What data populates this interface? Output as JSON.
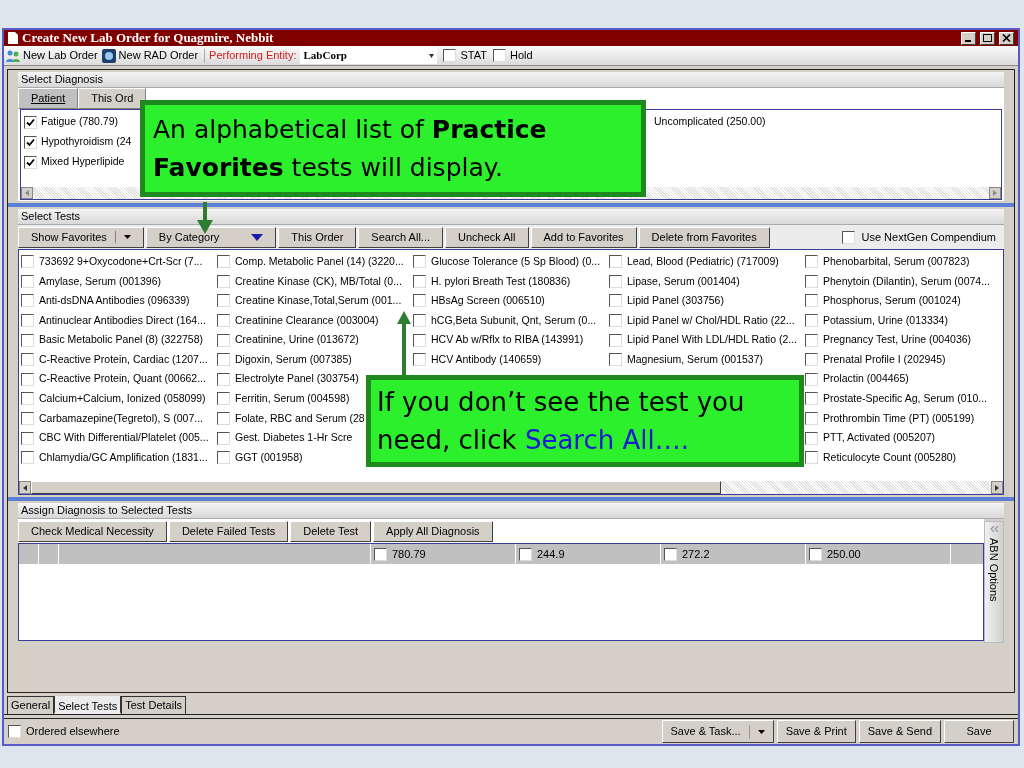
{
  "window": {
    "title": "Create New Lab Order for Quagmire, Nebbit"
  },
  "toolbar": {
    "new_lab_order": "New Lab Order",
    "new_rad_order": "New RAD Order",
    "performing_entity_label": "Performing Entity:",
    "performing_entity_value": "LabCorp",
    "options": [
      {
        "label": "STAT",
        "checked": false
      },
      {
        "label": "Hold",
        "checked": false
      }
    ]
  },
  "select_diagnosis": {
    "title": "Select Diagnosis",
    "tabs": [
      {
        "label": "Patient",
        "selected": true
      },
      {
        "label": "This Ord",
        "selected": false
      }
    ],
    "items": [
      {
        "label": "Fatigue (780.79)",
        "checked": true
      },
      {
        "label": "Hypothyroidism (24",
        "checked": true
      },
      {
        "label": "Mixed Hyperlipide",
        "checked": true
      }
    ],
    "partial_item": "Uncomplicated (250.00)"
  },
  "select_tests": {
    "title": "Select Tests",
    "buttons": [
      {
        "label": "Show Favorites",
        "kind": "split"
      },
      {
        "label": "By Category",
        "kind": "dropdown"
      },
      {
        "label": "This Order",
        "kind": "plain"
      },
      {
        "label": "Search All...",
        "kind": "plain"
      },
      {
        "label": "Uncheck All",
        "kind": "plain"
      },
      {
        "label": "Add to Favorites",
        "kind": "plain"
      },
      {
        "label": "Delete from Favorites",
        "kind": "plain"
      }
    ],
    "compendium": {
      "label": "Use NextGen Compendium",
      "checked": false
    },
    "columns": [
      [
        {
          "label": "733692 9+Oxycodone+Crt-Scr (7...",
          "checked": false
        },
        {
          "label": "Amylase, Serum (001396)",
          "checked": false
        },
        {
          "label": "Anti-dsDNA Antibodies (096339)",
          "checked": false
        },
        {
          "label": "Antinuclear Antibodies Direct (164...",
          "checked": false
        },
        {
          "label": "Basic Metabolic Panel (8) (322758)",
          "checked": false
        },
        {
          "label": "C-Reactive Protein, Cardiac (1207...",
          "checked": false
        },
        {
          "label": "C-Reactive Protein, Quant (00662...",
          "checked": false
        },
        {
          "label": "Calcium+Calcium, Ionized (058099)",
          "checked": false
        },
        {
          "label": "Carbamazepine(Tegretol), S (007...",
          "checked": false
        },
        {
          "label": "CBC With Differential/Platelet (005...",
          "checked": false
        },
        {
          "label": "Chlamydia/GC Amplification (1831...",
          "checked": false
        }
      ],
      [
        {
          "label": "Comp. Metabolic Panel (14) (3220...",
          "checked": false
        },
        {
          "label": "Creatine Kinase (CK), MB/Total (0...",
          "checked": false
        },
        {
          "label": "Creatine Kinase,Total,Serum (001...",
          "checked": false
        },
        {
          "label": "Creatinine Clearance (003004)",
          "checked": false
        },
        {
          "label": "Creatinine, Urine (013672)",
          "checked": false
        },
        {
          "label": "Digoxin, Serum (007385)",
          "checked": false
        },
        {
          "label": "Electrolyte Panel (303754)",
          "checked": false
        },
        {
          "label": "Ferritin, Serum (004598)",
          "checked": false
        },
        {
          "label": "Folate, RBC and Serum (28",
          "checked": false
        },
        {
          "label": "Gest. Diabetes 1-Hr Scre",
          "checked": false
        },
        {
          "label": "GGT (001958)",
          "checked": false
        }
      ],
      [
        {
          "label": "Glucose Tolerance (5 Sp Blood) (0...",
          "checked": false
        },
        {
          "label": "H. pylori Breath Test (180836)",
          "checked": false
        },
        {
          "label": "HBsAg Screen (006510)",
          "checked": false
        },
        {
          "label": "hCG,Beta Subunit, Qnt, Serum (0...",
          "checked": false
        },
        {
          "label": "HCV Ab w/Rflx to RIBA (143991)",
          "checked": false
        },
        {
          "label": "HCV Antibody (140659)",
          "checked": false
        }
      ],
      [
        {
          "label": "Lead, Blood (Pediatric) (717009)",
          "checked": false
        },
        {
          "label": "Lipase, Serum (001404)",
          "checked": false
        },
        {
          "label": "Lipid Panel (303756)",
          "checked": false
        },
        {
          "label": "Lipid Panel w/ Chol/HDL Ratio (22...",
          "checked": false
        },
        {
          "label": "Lipid Panel With LDL/HDL Ratio (2...",
          "checked": false
        },
        {
          "label": "Magnesium, Serum (001537)",
          "checked": false
        }
      ],
      [
        {
          "label": "Phenobarbital, Serum (007823)",
          "checked": false
        },
        {
          "label": "Phenytoin (Dilantin), Serum (0074...",
          "checked": false
        },
        {
          "label": "Phosphorus, Serum (001024)",
          "checked": false
        },
        {
          "label": "Potassium, Urine (013334)",
          "checked": false
        },
        {
          "label": "Pregnancy Test, Urine (004036)",
          "checked": false
        },
        {
          "label": "Prenatal Profile I (202945)",
          "checked": false
        },
        {
          "label": "Prolactin (004465)",
          "checked": false
        },
        {
          "label": "Prostate-Specific Ag, Serum (010...",
          "checked": false
        },
        {
          "label": "Prothrombin Time (PT) (005199)",
          "checked": false
        },
        {
          "label": "PTT, Activated (005207)",
          "checked": false
        },
        {
          "label": "Reticulocyte Count (005280)",
          "checked": false
        }
      ]
    ]
  },
  "assign": {
    "title": "Assign Diagnosis to Selected Tests",
    "buttons": [
      "Check Medical Necessity",
      "Delete Failed Tests",
      "Delete Test",
      "Apply All Diagnosis"
    ],
    "codes": [
      {
        "label": "780.79",
        "checked": false
      },
      {
        "label": "244.9",
        "checked": false
      },
      {
        "label": "272.2",
        "checked": false
      },
      {
        "label": "250.00",
        "checked": false
      }
    ],
    "side_tab": "ABN Options"
  },
  "bottom_tabs": [
    {
      "label": "General",
      "selected": false
    },
    {
      "label": "Select Tests",
      "selected": true
    },
    {
      "label": "Test Details",
      "selected": false
    }
  ],
  "footer": {
    "ordered_elsewhere": {
      "label": "Ordered elsewhere",
      "checked": false
    },
    "buttons": [
      {
        "label": "Save & Task...",
        "kind": "split"
      },
      {
        "label": "Save & Print",
        "kind": "plain"
      },
      {
        "label": "Save & Send",
        "kind": "plain"
      },
      {
        "label": "Save",
        "kind": "plain"
      }
    ]
  },
  "callouts": [
    {
      "text": "An alphabetical list of **Practice Favorites** tests will display."
    },
    {
      "text": "If you don’t see the test you need, click ",
      "highlight": "Search All…."
    }
  ]
}
